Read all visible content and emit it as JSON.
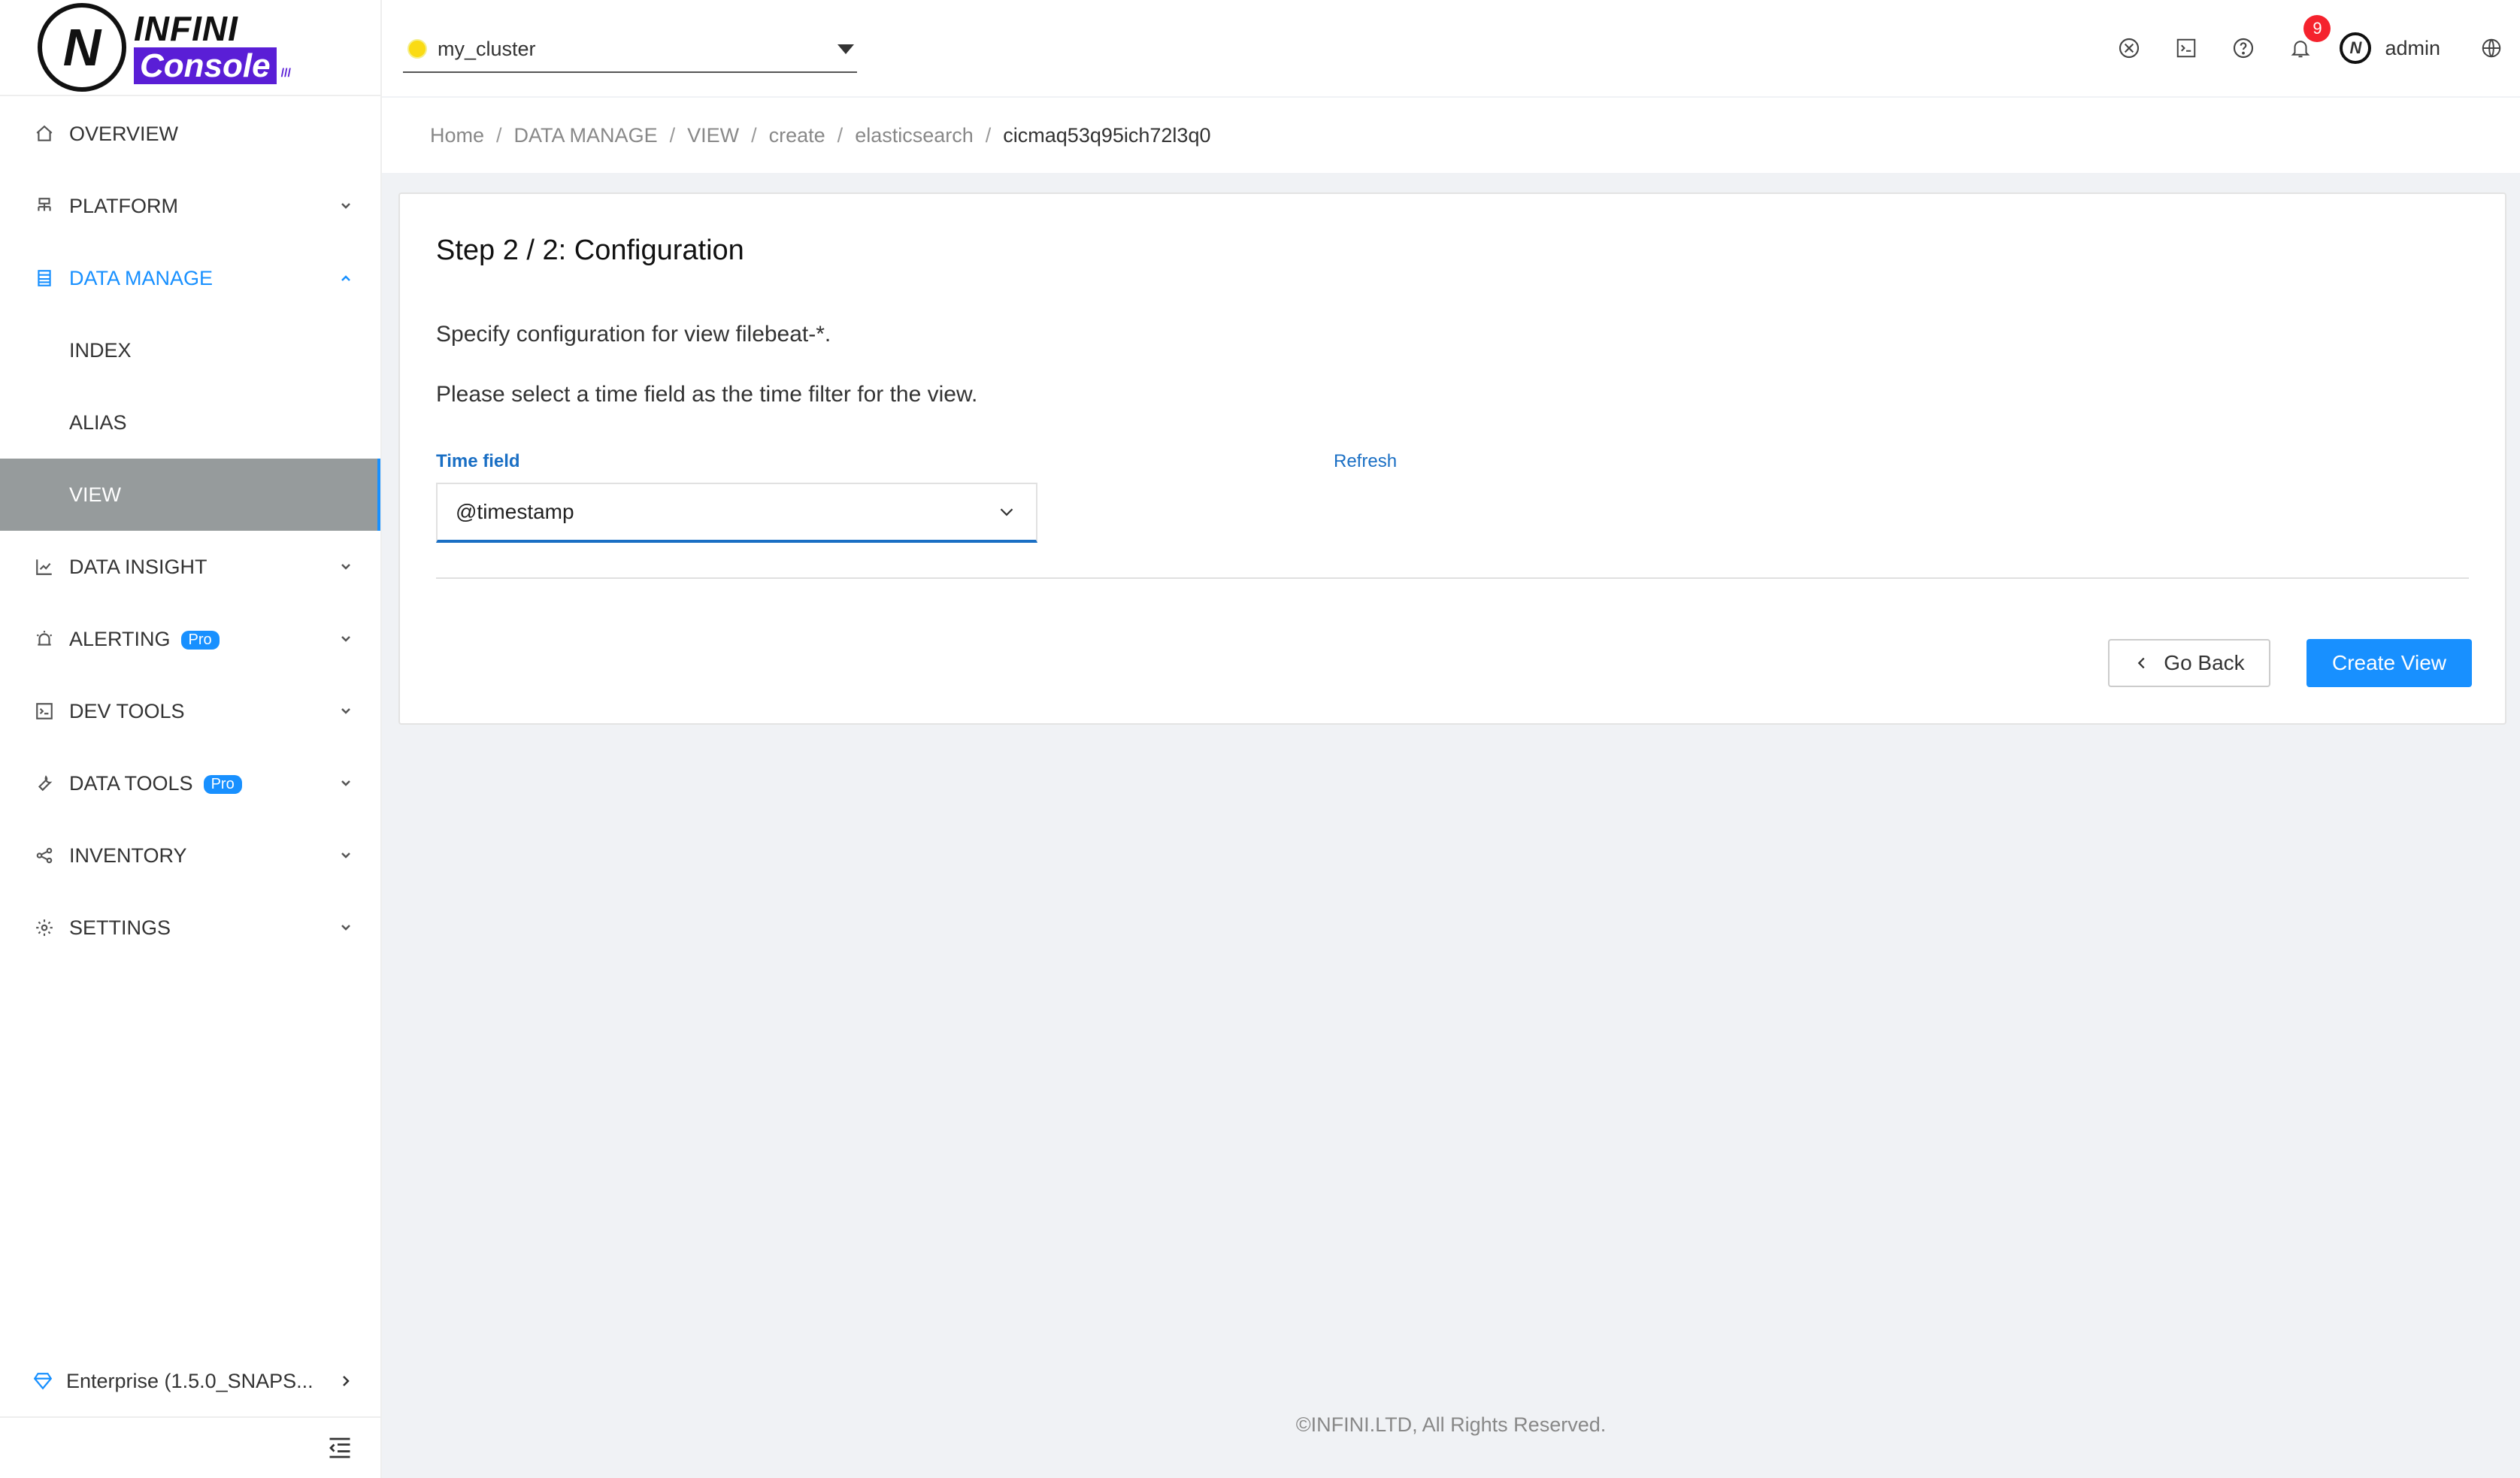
{
  "app": {
    "logo_top": "INFINI",
    "logo_bottom": "Console"
  },
  "header": {
    "cluster": "my_cluster",
    "notifications_count": "9",
    "user": "admin",
    "icons": [
      "plugin-icon",
      "terminal-icon",
      "help-icon",
      "bell-icon",
      "globe-icon"
    ]
  },
  "sidebar": {
    "items": [
      {
        "label": "OVERVIEW",
        "icon": "home-icon"
      },
      {
        "label": "PLATFORM",
        "icon": "cluster-icon"
      },
      {
        "label": "DATA MANAGE",
        "icon": "database-icon"
      },
      {
        "label": "INDEX"
      },
      {
        "label": "ALIAS"
      },
      {
        "label": "VIEW"
      },
      {
        "label": "DATA INSIGHT",
        "icon": "chart-icon"
      },
      {
        "label": "ALERTING",
        "icon": "alarm-icon",
        "badge": "Pro"
      },
      {
        "label": "DEV TOOLS",
        "icon": "terminal-icon"
      },
      {
        "label": "DATA TOOLS",
        "icon": "wrench-icon",
        "badge": "Pro"
      },
      {
        "label": "INVENTORY",
        "icon": "share-icon"
      },
      {
        "label": "SETTINGS",
        "icon": "gear-icon"
      }
    ],
    "version": "Enterprise (1.5.0_SNAPS..."
  },
  "breadcrumb": [
    "Home",
    "DATA MANAGE",
    "VIEW",
    "create",
    "elasticsearch",
    "cicmaq53q95ich72l3q0"
  ],
  "form": {
    "title": "Step 2 / 2: Configuration",
    "description": "Specify configuration for view filebeat-*.",
    "instruction": "Please select a time field as the time filter for the view.",
    "time_field_label": "Time field",
    "refresh_label": "Refresh",
    "time_field_value": "@timestamp",
    "back_label": "Go Back",
    "create_label": "Create View"
  },
  "footer": "©INFINI.LTD, All Rights Reserved.",
  "colors": {
    "accent": "#1890ff",
    "brand": "#5a1ed6",
    "selected_bg": "#969b9c",
    "badge": "#f5222d"
  }
}
